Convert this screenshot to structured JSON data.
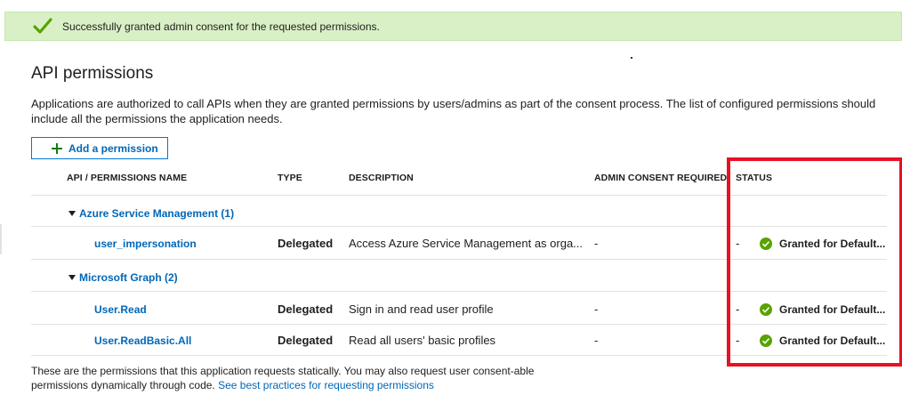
{
  "banner": {
    "message": "Successfully granted admin consent for the requested permissions.",
    "icon": "check-icon",
    "color": "#d9f0c6"
  },
  "page": {
    "title": "API permissions",
    "description": "Applications are authorized to call APIs when they are granted permissions by users/admins as part of the consent process. The list of configured permissions should include all the permissions the application needs.",
    "add_button_label": "Add a permission"
  },
  "table": {
    "headers": {
      "name": "API / PERMISSIONS NAME",
      "type": "TYPE",
      "description": "DESCRIPTION",
      "admin_consent": "ADMIN CONSENT REQUIRED",
      "status": "STATUS"
    },
    "groups": [
      {
        "label": "Azure Service Management (1)",
        "rows": [
          {
            "name": "user_impersonation",
            "type": "Delegated",
            "description": "Access Azure Service Management as orga...",
            "admin_consent": "-",
            "status_dash": "-",
            "status": "Granted for Default..."
          }
        ]
      },
      {
        "label": "Microsoft Graph (2)",
        "rows": [
          {
            "name": "User.Read",
            "type": "Delegated",
            "description": "Sign in and read user profile",
            "admin_consent": "-",
            "status_dash": "-",
            "status": "Granted for Default..."
          },
          {
            "name": "User.ReadBasic.All",
            "type": "Delegated",
            "description": "Read all users' basic profiles",
            "admin_consent": "-",
            "status_dash": "-",
            "status": "Granted for Default..."
          }
        ]
      }
    ]
  },
  "footer": {
    "text": "These are the permissions that this application requests statically. You may also request user consent-able permissions dynamically through code.",
    "link": "See best practices for requesting permissions"
  },
  "colors": {
    "accent": "#0067b8",
    "success": "#57a300",
    "highlight_box": "#e81123"
  }
}
